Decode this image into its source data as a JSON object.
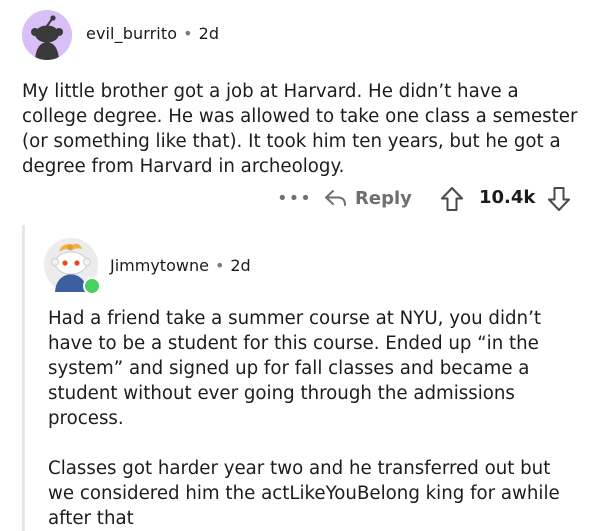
{
  "comment1": {
    "username": "evil_burrito",
    "separator": "•",
    "time": "2d",
    "body": "My little brother got a job at Harvard. He didn’t have a college degree. He was allowed to take one class a semester (or something like that). It took him ten years, but he got a degree from Harvard in archeology.",
    "actions": {
      "more_label": "•••",
      "reply_label": "Reply",
      "score": "10.4k"
    },
    "avatar_bg": "#d8bff5"
  },
  "comment2": {
    "username": "Jimmytowne",
    "separator": "•",
    "time": "2d",
    "paragraphs": [
      "Had a friend take a summer course at NYU, you didn’t have to be a student for this course. Ended up “in the system” and signed up for fall classes and became a student without ever going through the admissions process.",
      "Classes got harder year two and he transferred out but we considered him the actLikeYouBelong king for awhile after that"
    ],
    "online_color": "#46d160"
  },
  "icons": {
    "reply": "reply-arrow-icon",
    "upvote": "upvote-arrow-icon",
    "downvote": "downvote-arrow-icon"
  }
}
